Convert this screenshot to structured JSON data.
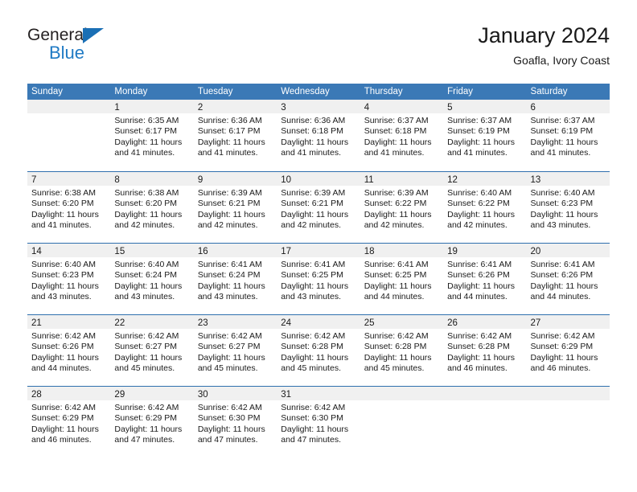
{
  "logo": {
    "word_one": "General",
    "word_two": "Blue",
    "triangle_color": "#1a6fb5",
    "blue_color": "#1f7ac4"
  },
  "header": {
    "title": "January 2024",
    "subtitle": "Goafla, Ivory Coast",
    "weekday_header_color": "#3b79b6"
  },
  "calendar": {
    "weekdays": [
      "Sunday",
      "Monday",
      "Tuesday",
      "Wednesday",
      "Thursday",
      "Friday",
      "Saturday"
    ],
    "weeks": [
      [
        {
          "day": "",
          "lines": []
        },
        {
          "day": "1",
          "lines": [
            "Sunrise: 6:35 AM",
            "Sunset: 6:17 PM",
            "Daylight: 11 hours",
            "and 41 minutes."
          ]
        },
        {
          "day": "2",
          "lines": [
            "Sunrise: 6:36 AM",
            "Sunset: 6:17 PM",
            "Daylight: 11 hours",
            "and 41 minutes."
          ]
        },
        {
          "day": "3",
          "lines": [
            "Sunrise: 6:36 AM",
            "Sunset: 6:18 PM",
            "Daylight: 11 hours",
            "and 41 minutes."
          ]
        },
        {
          "day": "4",
          "lines": [
            "Sunrise: 6:37 AM",
            "Sunset: 6:18 PM",
            "Daylight: 11 hours",
            "and 41 minutes."
          ]
        },
        {
          "day": "5",
          "lines": [
            "Sunrise: 6:37 AM",
            "Sunset: 6:19 PM",
            "Daylight: 11 hours",
            "and 41 minutes."
          ]
        },
        {
          "day": "6",
          "lines": [
            "Sunrise: 6:37 AM",
            "Sunset: 6:19 PM",
            "Daylight: 11 hours",
            "and 41 minutes."
          ]
        }
      ],
      [
        {
          "day": "7",
          "lines": [
            "Sunrise: 6:38 AM",
            "Sunset: 6:20 PM",
            "Daylight: 11 hours",
            "and 41 minutes."
          ]
        },
        {
          "day": "8",
          "lines": [
            "Sunrise: 6:38 AM",
            "Sunset: 6:20 PM",
            "Daylight: 11 hours",
            "and 42 minutes."
          ]
        },
        {
          "day": "9",
          "lines": [
            "Sunrise: 6:39 AM",
            "Sunset: 6:21 PM",
            "Daylight: 11 hours",
            "and 42 minutes."
          ]
        },
        {
          "day": "10",
          "lines": [
            "Sunrise: 6:39 AM",
            "Sunset: 6:21 PM",
            "Daylight: 11 hours",
            "and 42 minutes."
          ]
        },
        {
          "day": "11",
          "lines": [
            "Sunrise: 6:39 AM",
            "Sunset: 6:22 PM",
            "Daylight: 11 hours",
            "and 42 minutes."
          ]
        },
        {
          "day": "12",
          "lines": [
            "Sunrise: 6:40 AM",
            "Sunset: 6:22 PM",
            "Daylight: 11 hours",
            "and 42 minutes."
          ]
        },
        {
          "day": "13",
          "lines": [
            "Sunrise: 6:40 AM",
            "Sunset: 6:23 PM",
            "Daylight: 11 hours",
            "and 43 minutes."
          ]
        }
      ],
      [
        {
          "day": "14",
          "lines": [
            "Sunrise: 6:40 AM",
            "Sunset: 6:23 PM",
            "Daylight: 11 hours",
            "and 43 minutes."
          ]
        },
        {
          "day": "15",
          "lines": [
            "Sunrise: 6:40 AM",
            "Sunset: 6:24 PM",
            "Daylight: 11 hours",
            "and 43 minutes."
          ]
        },
        {
          "day": "16",
          "lines": [
            "Sunrise: 6:41 AM",
            "Sunset: 6:24 PM",
            "Daylight: 11 hours",
            "and 43 minutes."
          ]
        },
        {
          "day": "17",
          "lines": [
            "Sunrise: 6:41 AM",
            "Sunset: 6:25 PM",
            "Daylight: 11 hours",
            "and 43 minutes."
          ]
        },
        {
          "day": "18",
          "lines": [
            "Sunrise: 6:41 AM",
            "Sunset: 6:25 PM",
            "Daylight: 11 hours",
            "and 44 minutes."
          ]
        },
        {
          "day": "19",
          "lines": [
            "Sunrise: 6:41 AM",
            "Sunset: 6:26 PM",
            "Daylight: 11 hours",
            "and 44 minutes."
          ]
        },
        {
          "day": "20",
          "lines": [
            "Sunrise: 6:41 AM",
            "Sunset: 6:26 PM",
            "Daylight: 11 hours",
            "and 44 minutes."
          ]
        }
      ],
      [
        {
          "day": "21",
          "lines": [
            "Sunrise: 6:42 AM",
            "Sunset: 6:26 PM",
            "Daylight: 11 hours",
            "and 44 minutes."
          ]
        },
        {
          "day": "22",
          "lines": [
            "Sunrise: 6:42 AM",
            "Sunset: 6:27 PM",
            "Daylight: 11 hours",
            "and 45 minutes."
          ]
        },
        {
          "day": "23",
          "lines": [
            "Sunrise: 6:42 AM",
            "Sunset: 6:27 PM",
            "Daylight: 11 hours",
            "and 45 minutes."
          ]
        },
        {
          "day": "24",
          "lines": [
            "Sunrise: 6:42 AM",
            "Sunset: 6:28 PM",
            "Daylight: 11 hours",
            "and 45 minutes."
          ]
        },
        {
          "day": "25",
          "lines": [
            "Sunrise: 6:42 AM",
            "Sunset: 6:28 PM",
            "Daylight: 11 hours",
            "and 45 minutes."
          ]
        },
        {
          "day": "26",
          "lines": [
            "Sunrise: 6:42 AM",
            "Sunset: 6:28 PM",
            "Daylight: 11 hours",
            "and 46 minutes."
          ]
        },
        {
          "day": "27",
          "lines": [
            "Sunrise: 6:42 AM",
            "Sunset: 6:29 PM",
            "Daylight: 11 hours",
            "and 46 minutes."
          ]
        }
      ],
      [
        {
          "day": "28",
          "lines": [
            "Sunrise: 6:42 AM",
            "Sunset: 6:29 PM",
            "Daylight: 11 hours",
            "and 46 minutes."
          ]
        },
        {
          "day": "29",
          "lines": [
            "Sunrise: 6:42 AM",
            "Sunset: 6:29 PM",
            "Daylight: 11 hours",
            "and 47 minutes."
          ]
        },
        {
          "day": "30",
          "lines": [
            "Sunrise: 6:42 AM",
            "Sunset: 6:30 PM",
            "Daylight: 11 hours",
            "and 47 minutes."
          ]
        },
        {
          "day": "31",
          "lines": [
            "Sunrise: 6:42 AM",
            "Sunset: 6:30 PM",
            "Daylight: 11 hours",
            "and 47 minutes."
          ]
        },
        {
          "day": "",
          "lines": []
        },
        {
          "day": "",
          "lines": []
        },
        {
          "day": "",
          "lines": []
        }
      ]
    ]
  }
}
